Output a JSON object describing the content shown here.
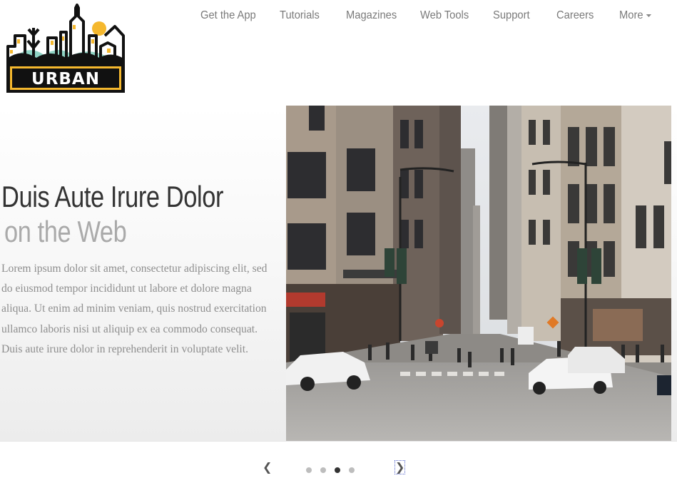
{
  "logo": {
    "text": "URBAN"
  },
  "nav": {
    "items": [
      {
        "label": "Get the App"
      },
      {
        "label": "Tutorials"
      },
      {
        "label": "Magazines"
      },
      {
        "label": "Web Tools"
      },
      {
        "label": "Support"
      },
      {
        "label": "Careers"
      },
      {
        "label": "More"
      }
    ]
  },
  "hero": {
    "title_line1": "Duis Aute Irure Dolor",
    "title_line2": "on the Web",
    "body": "Lorem ipsum dolor sit amet, consectetur adipiscing elit, sed do eiusmod tempor incididunt ut labore et dolore magna aliqua. Ut enim ad minim veniam, quis nostrud exercitation ullamco laboris nisi ut aliquip ex ea commodo consequat. Duis aute irure dolor in reprehenderit in voluptate velit.",
    "image_icon": "city-street-photo"
  },
  "carousel": {
    "prev_label": "❮",
    "next_label": "❯",
    "slide_count": 4,
    "active_index": 2
  },
  "colors": {
    "logo_yellow": "#f5b82e",
    "logo_teal": "#8fd3c4",
    "nav_text": "#7a7a7a",
    "title_dark": "#333333",
    "title_light": "#aaaaaa"
  }
}
